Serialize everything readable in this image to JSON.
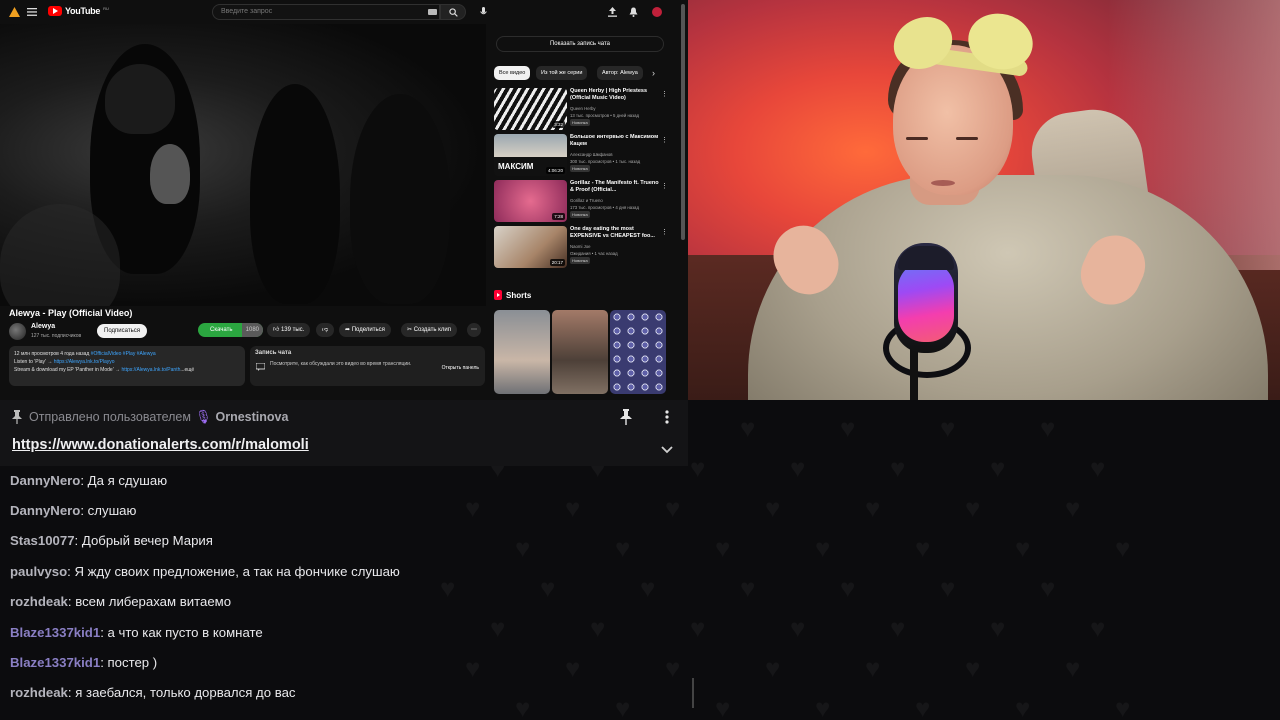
{
  "youtube": {
    "logo_text": "YouTube",
    "logo_country": "RU",
    "search_placeholder": "Введите запрос",
    "video_title": "Alewya - Play (Official Video)",
    "channel": {
      "name": "Alewya",
      "subs": "127 тыс. подписчиков"
    },
    "subscribe_label": "Подписаться",
    "download_label": "Скачать",
    "download_count": "1080",
    "like_count": "139 тыс.",
    "share_label": "Поделиться",
    "clip_label": "Создать клип",
    "description": {
      "line1_views": "12 млн просмотров  4 года назад",
      "line1_tags": "#OfficialVideo #Play #Alewya",
      "line2_text": "Listen to 'Play' → ",
      "line2_link": "https://Alewya.lnk.to/Playyo",
      "line3_text": "Stream & download my EP 'Panther in Mode' → ",
      "line3_link": "https://Alewya.lnk.to/Panth",
      "more": "...ещё"
    },
    "chat_record": {
      "title": "Запись чата",
      "text": "Посмотрите, как обсуждали это видео во время трансляции.",
      "button": "Открыть панель"
    },
    "show_chat_label": "Показать запись чата",
    "chips": [
      "Все видео",
      "Из той же серии",
      "Автор: Alewya"
    ],
    "recommendations": [
      {
        "title": "Queen Herby | High Priestess (Official Music Video)",
        "channel": "Queen Herby",
        "meta": "13 тыс. просмотров • 5 дней назад",
        "badge": "Новинка",
        "duration": "3:32"
      },
      {
        "title": "Большое интервью с Максимом Кацем",
        "channel": "Александр Шмфанов",
        "meta": "300 тыс. просмотров • 1 тыс. назад",
        "badge": "Новинка",
        "duration": "4:06:20",
        "thumb_text": "МАКСИМ"
      },
      {
        "title": "Gorillaz - The Manifesto ft. Trueno & Proof (Official...",
        "channel": "Gorillaz и Trueno",
        "meta": "173 тыс. просмотров • 4 дня назад",
        "badge": "Новинка",
        "duration": "7:28"
      },
      {
        "title": "One day eating the most EXPENSIVE vs CHEAPEST foo...",
        "channel": "Naomi Joe",
        "meta": "Ожидания • 1 час назад",
        "badge": "Новинка",
        "duration": "20:17"
      }
    ],
    "shorts_label": "Shorts"
  },
  "chat": {
    "pinned": {
      "prefix": "Отправлено пользователем",
      "user": "Ornestinova",
      "link": "https://www.donationalerts.com/r/malomoli"
    },
    "messages": [
      {
        "user": "DannyNero",
        "color": "#b4b4bc",
        "text": ": Да я сдушаю"
      },
      {
        "user": "DannyNero",
        "color": "#b4b4bc",
        "text": ": слушаю"
      },
      {
        "user": "Stas10077",
        "color": "#b4b4bc",
        "text": ": Добрый вечер Мария"
      },
      {
        "user": "paulvyso",
        "color": "#b4b4bc",
        "text": ": Я жду своих предложение, а так на фончике слушаю"
      },
      {
        "user": "rozhdeak",
        "color": "#b4b4bc",
        "text": ": всем либерахам витаемо"
      },
      {
        "user": "Blaze1337kid1",
        "color": "#8a7fc4",
        "text": ": а что как пусто в комнате"
      },
      {
        "user": "Blaze1337kid1",
        "color": "#8a7fc4",
        "text": ": постер )"
      },
      {
        "user": "rozhdeak",
        "color": "#b4b4bc",
        "text": ": я заебался, только дорвался до вас"
      }
    ]
  }
}
